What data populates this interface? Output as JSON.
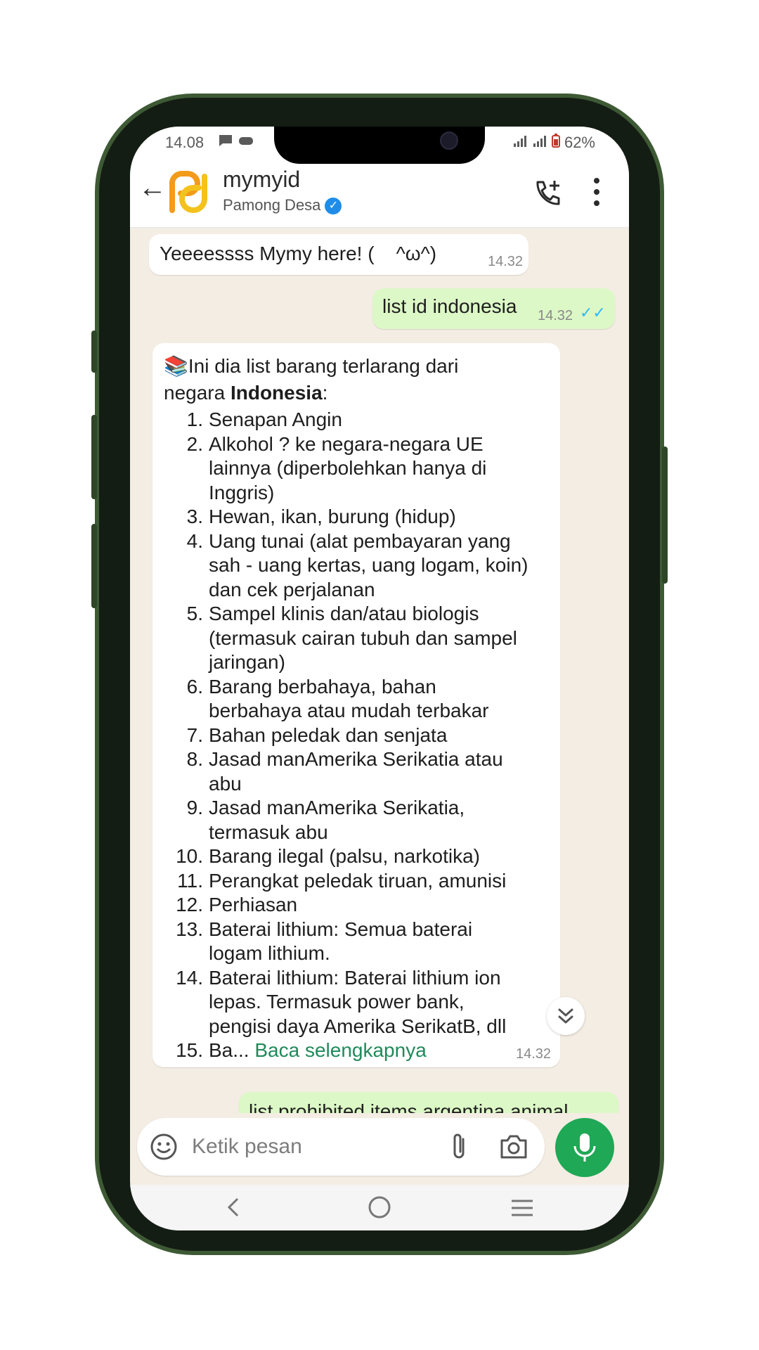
{
  "status_bar": {
    "time": "14.08",
    "battery": "62%"
  },
  "header": {
    "title": "mymyid",
    "subtitle": "Pamong Desa"
  },
  "messages": {
    "m1": {
      "text": "Yeeeessss Mymy here! (    ^ω^)",
      "time": "14.32"
    },
    "m2": {
      "text": "list id indonesia",
      "time": "14.32"
    },
    "m3": {
      "intro_prefix": "📚Ini dia list barang terlarang dari negara ",
      "intro_bold": "Indonesia",
      "intro_suffix": ":",
      "items": [
        {
          "num": "1.",
          "text": "Senapan Angin"
        },
        {
          "num": "2.",
          "text": "Alkohol ? ke negara-negara UE lainnya (diperbolehkan hanya di Inggris)"
        },
        {
          "num": "3.",
          "text": "Hewan, ikan, burung (hidup)"
        },
        {
          "num": "4.",
          "text": "Uang tunai (alat pembayaran yang sah - uang kertas, uang logam, koin) dan cek perjalanan"
        },
        {
          "num": "5.",
          "text": "Sampel klinis dan/atau biologis (termasuk cairan tubuh dan sampel jaringan)"
        },
        {
          "num": "6.",
          "text": "Barang berbahaya, bahan berbahaya atau mudah terbakar"
        },
        {
          "num": "7.",
          "text": "Bahan peledak dan senjata"
        },
        {
          "num": "8.",
          "text": "Jasad manAmerika Serikatia atau abu"
        },
        {
          "num": "9.",
          "text": "Jasad manAmerika Serikatia, termasuk abu"
        },
        {
          "num": "10.",
          "text": "Barang ilegal (palsu, narkotika)"
        },
        {
          "num": "11.",
          "text": "Perangkat peledak tiruan, amunisi"
        },
        {
          "num": "12.",
          "text": "Perhiasan"
        },
        {
          "num": "13.",
          "text": "Baterai lithium: Semua baterai logam lithium."
        },
        {
          "num": "14.",
          "text": "Baterai lithium: Baterai lithium ion lepas. Termasuk power bank, pengisi daya Amerika SerikatB, dll"
        }
      ],
      "last_num": "15.",
      "last_text": "Ba...",
      "read_more": "Baca selengkapnya",
      "time": "14.32"
    },
    "m4": {
      "text": "list prohibited items argentina animal"
    }
  },
  "input": {
    "placeholder": "Ketik pesan"
  },
  "colors": {
    "accent": "#1fa855",
    "outgoing_bubble": "#dcf8c6",
    "chat_background": "#f4ede4",
    "link": "#1f8a5a"
  },
  "icons": [
    "back-arrow-icon",
    "avatar-logo",
    "verified-badge-icon",
    "add-call-icon",
    "more-vert-icon",
    "emoji-icon",
    "attach-icon",
    "camera-icon",
    "mic-icon",
    "double-chevron-down-icon",
    "nav-back-icon",
    "nav-home-icon",
    "nav-recents-icon"
  ]
}
